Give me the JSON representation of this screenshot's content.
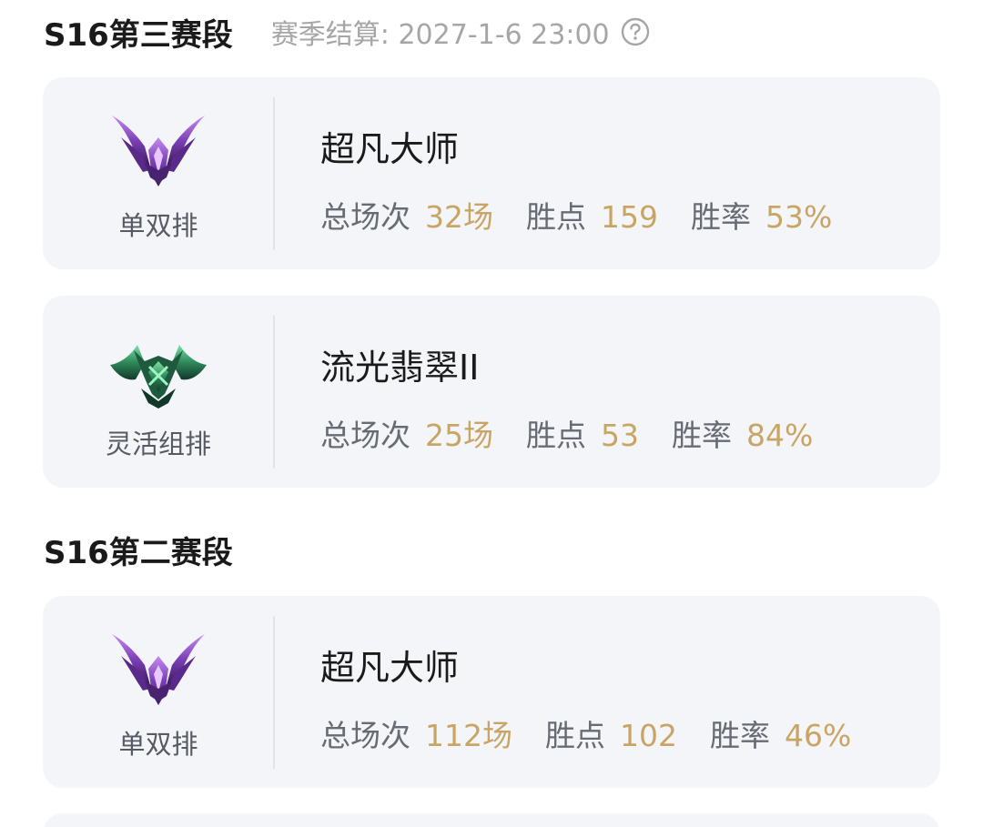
{
  "sections": [
    {
      "title": "S16第三赛段",
      "settlement": "赛季结算: 2027-1-6 23:00",
      "cards": [
        {
          "emblem": "master-purple-wings-emblem",
          "queue": "单双排",
          "rank": "超凡大师",
          "stats": [
            {
              "label": "总场次",
              "value": "32场"
            },
            {
              "label": "胜点",
              "value": "159"
            },
            {
              "label": "胜率",
              "value": "53%"
            }
          ]
        },
        {
          "emblem": "emerald-green-wings-emblem",
          "queue": "灵活组排",
          "rank": "流光翡翠II",
          "stats": [
            {
              "label": "总场次",
              "value": "25场"
            },
            {
              "label": "胜点",
              "value": "53"
            },
            {
              "label": "胜率",
              "value": "84%"
            }
          ]
        }
      ]
    },
    {
      "title": "S16第二赛段",
      "cards": [
        {
          "emblem": "master-purple-wings-emblem",
          "queue": "单双排",
          "rank": "超凡大师",
          "stats": [
            {
              "label": "总场次",
              "value": "112场"
            },
            {
              "label": "胜点",
              "value": "102"
            },
            {
              "label": "胜率",
              "value": "46%"
            }
          ]
        }
      ]
    }
  ],
  "colors": {
    "accent_gold": "#c9a565",
    "card_bg": "#f4f5f9",
    "master_purple": "#7b3fb5",
    "emerald_green": "#2e8a5a"
  }
}
